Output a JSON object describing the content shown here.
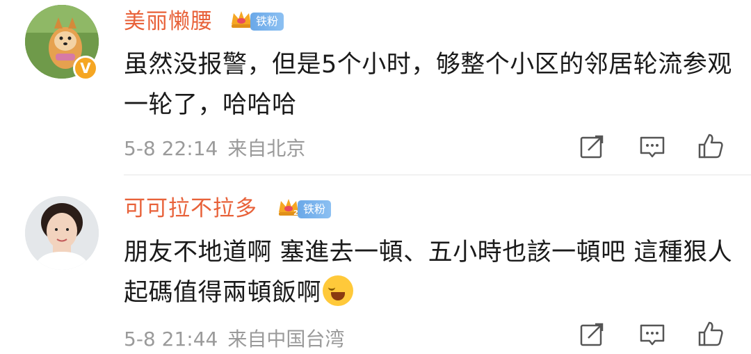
{
  "comments": [
    {
      "username": "美丽懒腰",
      "fan_badge": "铁粉",
      "crown_level": "",
      "verified": "V",
      "text": "虽然没报警，但是5个小时，够整个小区的邻居轮流参观一轮了，哈哈哈",
      "time": "5-8 22:14",
      "source": "来自北京",
      "avatar_icon": "shiba-dog-avatar"
    },
    {
      "username": "可可拉不拉多",
      "fan_badge": "铁粉",
      "crown_level": "2",
      "text": "朋友不地道啊 塞進去一頓、五小時也該一頓吧 這種狠人 起碼值得兩頓飯啊",
      "emoji": "laughing-crying-emoji",
      "time": "5-8 21:44",
      "source": "来自中国台湾",
      "avatar_icon": "woman-portrait-avatar"
    }
  ],
  "colors": {
    "username": "#e8623a",
    "meta": "#9a9a9a",
    "fan_badge": "#6aa8e8",
    "divider": "#e6e6e6"
  },
  "icons": [
    "share-icon",
    "comment-icon",
    "like-icon",
    "crown-icon"
  ]
}
